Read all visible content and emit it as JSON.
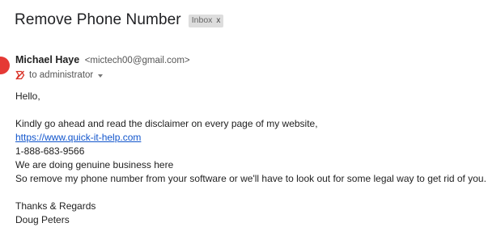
{
  "email": {
    "subject": "Remove Phone Number",
    "label": "Inbox",
    "label_remove": "x",
    "sender_name": "Michael Haye",
    "sender_email": "<mictech00@gmail.com>",
    "recipient": "to administrator",
    "icons": {
      "avatar": "avatar",
      "not-important": "important-marker-icon",
      "details": "chevron-down-icon"
    },
    "colors": {
      "link": "#1155cc",
      "avatar": "#e53935",
      "chip_bg": "#dddddd"
    },
    "body": {
      "greeting": "Hello,",
      "line1": "Kindly go ahead and read the disclaimer on every page of my website,",
      "link": "https://www.quick-it-help.com",
      "phone": "1-888-683-9566",
      "line2": "We are doing genuine business here",
      "line3": "So remove my phone number from your software or we'll have to look out for some legal way to get rid of you.",
      "closing": "Thanks & Regards",
      "signature": "Doug Peters"
    }
  }
}
